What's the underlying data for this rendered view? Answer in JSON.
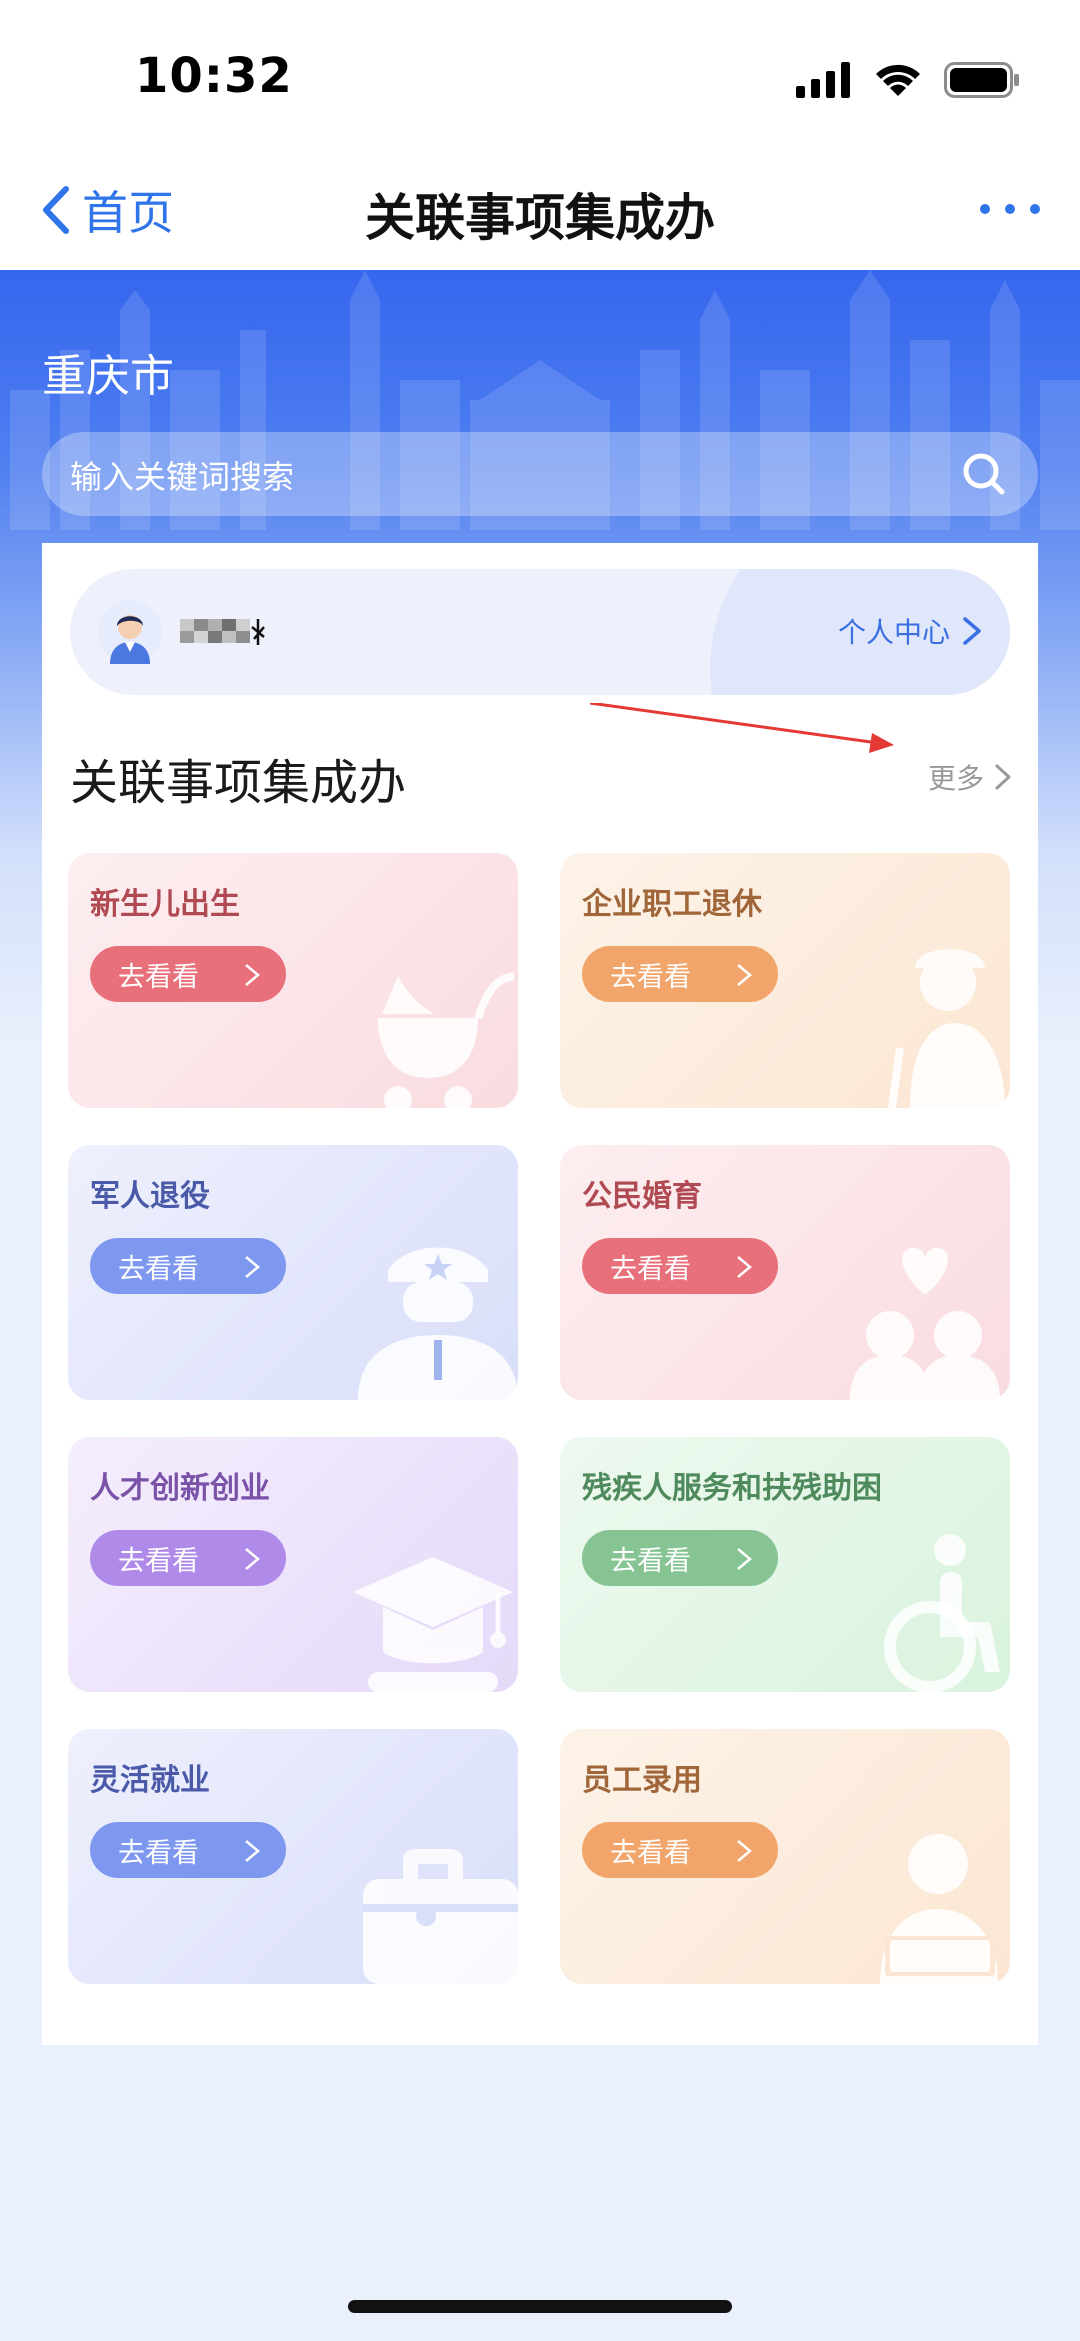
{
  "status_bar": {
    "time": "10:32"
  },
  "nav": {
    "back_label": "首页",
    "title": "关联事项集成办"
  },
  "hero": {
    "city": "重庆市",
    "search_placeholder": "输入关键词搜索"
  },
  "user_card": {
    "profile_link": "个人中心"
  },
  "section": {
    "title": "关联事项集成办",
    "more": "更多"
  },
  "cards": [
    {
      "title": "新生儿出生",
      "button": "去看看",
      "icon": "baby-stroller-icon"
    },
    {
      "title": "企业职工退休",
      "button": "去看看",
      "icon": "elderly-person-icon"
    },
    {
      "title": "军人退役",
      "button": "去看看",
      "icon": "soldier-icon"
    },
    {
      "title": "公民婚育",
      "button": "去看看",
      "icon": "couple-heart-icon"
    },
    {
      "title": "人才创新创业",
      "button": "去看看",
      "icon": "graduation-cap-icon"
    },
    {
      "title": "残疾人服务和扶残助困",
      "button": "去看看",
      "icon": "wheelchair-icon"
    },
    {
      "title": "灵活就业",
      "button": "去看看",
      "icon": "briefcase-icon"
    },
    {
      "title": "员工录用",
      "button": "去看看",
      "icon": "employee-laptop-icon"
    }
  ],
  "colors": {
    "accent": "#2f74e8",
    "hero_top": "#3566ee",
    "page_bg": "#eaf0fc",
    "annotation_arrow": "#e53935"
  }
}
